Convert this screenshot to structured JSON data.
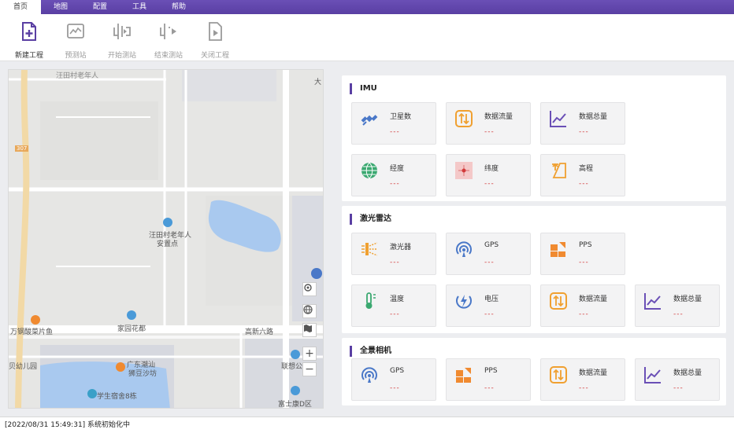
{
  "menubar": {
    "tabs": [
      {
        "label": "首页",
        "active": true
      },
      {
        "label": "地图"
      },
      {
        "label": "配置"
      },
      {
        "label": "工具"
      },
      {
        "label": "帮助"
      }
    ]
  },
  "toolbar": {
    "new_project": "新建工程",
    "pre_station": "预测站",
    "start_station": "开始测站",
    "end_station": "结束测站",
    "close_project": "关闭工程"
  },
  "map": {
    "labels": {
      "top_road": "汪田村老年人",
      "top_right": "大",
      "road_badge": "307",
      "elderly_home_1": "汪田村老年人",
      "elderly_home_2": "安置点",
      "restaurant": "万钢酸菜片鱼",
      "jiayuan": "家园花都",
      "gaoxin_road": "高新六路",
      "kindergarten": "贝幼儿园",
      "guangdong_1": "广东潮汕",
      "guangdong_2": "狮豆沙坊",
      "student_dorm": "学生宿舍8栋",
      "lianxiang": "联想公",
      "fushi": "富士康D区",
      "zoom_in": "+",
      "zoom_out": "−"
    }
  },
  "imu": {
    "title": "IMU",
    "cards": [
      {
        "name": "卫星数",
        "value": "---"
      },
      {
        "name": "数据流量",
        "value": "---"
      },
      {
        "name": "数据总量",
        "value": "---"
      },
      {
        "name": "经度",
        "value": "---"
      },
      {
        "name": "纬度",
        "value": "---"
      },
      {
        "name": "高程",
        "value": "---"
      }
    ]
  },
  "lidar": {
    "title": "激光雷达",
    "cards": [
      {
        "name": "激光器",
        "value": "---"
      },
      {
        "name": "GPS",
        "value": "---"
      },
      {
        "name": "PPS",
        "value": "---"
      },
      {
        "name": "温度",
        "value": "---"
      },
      {
        "name": "电压",
        "value": "---"
      },
      {
        "name": "数据流量",
        "value": "---"
      },
      {
        "name": "数据总量",
        "value": "---"
      }
    ]
  },
  "camera": {
    "title": "全景相机",
    "cards": [
      {
        "name": "GPS",
        "value": "---"
      },
      {
        "name": "PPS",
        "value": "---"
      },
      {
        "name": "数据流量",
        "value": "---"
      },
      {
        "name": "数据总量",
        "value": "---"
      }
    ]
  },
  "status": {
    "log": "[2022/08/31 15:49:31] 系统初始化中"
  },
  "colors": {
    "accent": "#5a3fa3",
    "value_red": "#d23a3a",
    "orange": "#f0a030",
    "purple_icon": "#6a4fb6",
    "blue_icon": "#4a78c8",
    "green_icon": "#3aa870",
    "water": "#a9c9ef"
  }
}
